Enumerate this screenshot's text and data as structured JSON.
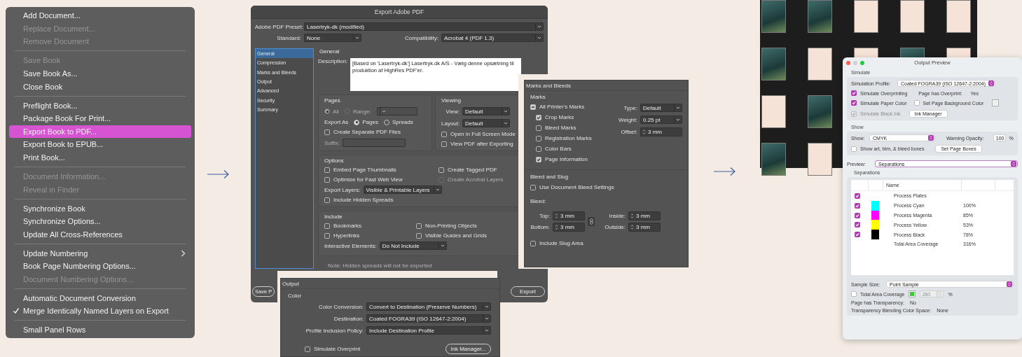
{
  "menu": {
    "items": [
      {
        "kind": "item",
        "label": "Add Document...",
        "disabled": false,
        "selected": false,
        "checked": false,
        "submenu": false
      },
      {
        "kind": "item",
        "label": "Replace Document...",
        "disabled": true,
        "selected": false,
        "checked": false,
        "submenu": false
      },
      {
        "kind": "item",
        "label": "Remove Document",
        "disabled": true,
        "selected": false,
        "checked": false,
        "submenu": false
      },
      {
        "kind": "separator"
      },
      {
        "kind": "item",
        "label": "Save Book",
        "disabled": true,
        "selected": false,
        "checked": false,
        "submenu": false
      },
      {
        "kind": "item",
        "label": "Save Book As...",
        "disabled": false,
        "selected": false,
        "checked": false,
        "submenu": false
      },
      {
        "kind": "item",
        "label": "Close Book",
        "disabled": false,
        "selected": false,
        "checked": false,
        "submenu": false
      },
      {
        "kind": "separator"
      },
      {
        "kind": "item",
        "label": "Preflight Book...",
        "disabled": false,
        "selected": false,
        "checked": false,
        "submenu": false
      },
      {
        "kind": "item",
        "label": "Package Book For Print...",
        "disabled": false,
        "selected": false,
        "checked": false,
        "submenu": false
      },
      {
        "kind": "item",
        "label": "Export Book to PDF...",
        "disabled": false,
        "selected": true,
        "checked": false,
        "submenu": false
      },
      {
        "kind": "item",
        "label": "Export Book to EPUB...",
        "disabled": false,
        "selected": false,
        "checked": false,
        "submenu": false
      },
      {
        "kind": "item",
        "label": "Print Book...",
        "disabled": false,
        "selected": false,
        "checked": false,
        "submenu": false
      },
      {
        "kind": "separator"
      },
      {
        "kind": "item",
        "label": "Document Information...",
        "disabled": true,
        "selected": false,
        "checked": false,
        "submenu": false
      },
      {
        "kind": "item",
        "label": "Reveal in Finder",
        "disabled": true,
        "selected": false,
        "checked": false,
        "submenu": false
      },
      {
        "kind": "separator"
      },
      {
        "kind": "item",
        "label": "Synchronize Book",
        "disabled": false,
        "selected": false,
        "checked": false,
        "submenu": false
      },
      {
        "kind": "item",
        "label": "Synchronize Options...",
        "disabled": false,
        "selected": false,
        "checked": false,
        "submenu": false
      },
      {
        "kind": "item",
        "label": "Update All Cross-References",
        "disabled": false,
        "selected": false,
        "checked": false,
        "submenu": false
      },
      {
        "kind": "separator"
      },
      {
        "kind": "item",
        "label": "Update Numbering",
        "disabled": false,
        "selected": false,
        "checked": false,
        "submenu": true
      },
      {
        "kind": "item",
        "label": "Book Page Numbering Options...",
        "disabled": false,
        "selected": false,
        "checked": false,
        "submenu": false
      },
      {
        "kind": "item",
        "label": "Document Numbering Options...",
        "disabled": true,
        "selected": false,
        "checked": false,
        "submenu": false
      },
      {
        "kind": "separator"
      },
      {
        "kind": "item",
        "label": "Automatic Document Conversion",
        "disabled": false,
        "selected": false,
        "checked": false,
        "submenu": false
      },
      {
        "kind": "item",
        "label": "Merge Identically Named Layers on Export",
        "disabled": false,
        "selected": false,
        "checked": true,
        "submenu": false
      },
      {
        "kind": "separator"
      },
      {
        "kind": "item",
        "label": "Small Panel Rows",
        "disabled": false,
        "selected": false,
        "checked": false,
        "submenu": false
      }
    ]
  },
  "export_dialog": {
    "title": "Export Adobe PDF",
    "preset": {
      "label": "Adobe PDF Preset:",
      "value": "Lasertryk-dk (modified)"
    },
    "standard": {
      "label": "Standard:",
      "value": "None"
    },
    "compatibility": {
      "label": "Compatibility:",
      "value": "Acrobat 4 (PDF 1.3)"
    },
    "sidebar": [
      {
        "label": "General",
        "selected": true
      },
      {
        "label": "Compression",
        "selected": false
      },
      {
        "label": "Marks and Bleeds",
        "selected": false
      },
      {
        "label": "Output",
        "selected": false
      },
      {
        "label": "Advanced",
        "selected": false
      },
      {
        "label": "Security",
        "selected": false
      },
      {
        "label": "Summary",
        "selected": false
      }
    ],
    "section_title": "General",
    "description": {
      "label": "Description:",
      "value": "[Based on 'Lasertryk-dk'] Lasertryk.dk A/S - Vælg denne opsætning til produktion af HighRes PDF'er."
    },
    "pages": {
      "title": "Pages",
      "range_options": [
        {
          "label": "All",
          "selected": true,
          "disabled": true
        },
        {
          "label": "Range:",
          "selected": false,
          "disabled": true
        }
      ],
      "export_as_label": "Export As",
      "export_as": [
        {
          "label": "Pages",
          "selected": true
        },
        {
          "label": "Spreads",
          "selected": false
        }
      ],
      "separate_files": {
        "label": "Create Separate PDF Files",
        "checked": false
      },
      "suffix_label": "Suffix:"
    },
    "viewing": {
      "title": "Viewing",
      "view": {
        "label": "View:",
        "value": "Default"
      },
      "layout": {
        "label": "Layout:",
        "value": "Default"
      },
      "checkboxes": [
        {
          "label": "Open in Full Screen Mode",
          "checked": false
        },
        {
          "label": "View PDF after Exporting",
          "checked": false
        }
      ]
    },
    "options": {
      "title": "Options",
      "checkboxes": [
        {
          "label": "Embed Page Thumbnails",
          "checked": false,
          "disabled": false
        },
        {
          "label": "Create Tagged PDF",
          "checked": false,
          "disabled": false
        },
        {
          "label": "Optimize for Fast Web View",
          "checked": false,
          "disabled": false
        },
        {
          "label": "Create Acrobat Layers",
          "checked": false,
          "disabled": true
        }
      ],
      "export_layers": {
        "label": "Export Layers:",
        "value": "Visible & Printable Layers"
      },
      "hidden_spreads": {
        "label": "Include Hidden Spreads",
        "checked": false
      }
    },
    "include": {
      "title": "Include",
      "checkboxes": [
        {
          "label": "Bookmarks",
          "checked": false
        },
        {
          "label": "Non-Printing Objects",
          "checked": false
        },
        {
          "label": "Hyperlinks",
          "checked": false
        },
        {
          "label": "Visible Guides and Grids",
          "checked": false
        }
      ],
      "interactive": {
        "label": "Interactive Elements:",
        "value": "Do Not Include"
      }
    },
    "note": "Note: Hidden spreads will not be exported",
    "buttons": [
      "Save P",
      "Export"
    ]
  },
  "marks_panel": {
    "title": "Marks and Bleeds",
    "marks_title": "Marks",
    "all_marks": {
      "label": "All Printer's Marks",
      "mixed": true
    },
    "marks": [
      {
        "label": "Crop Marks",
        "checked": true
      },
      {
        "label": "Bleed Marks",
        "checked": false
      },
      {
        "label": "Registration Marks",
        "checked": false
      },
      {
        "label": "Color Bars",
        "checked": false
      },
      {
        "label": "Page Information",
        "checked": true
      }
    ],
    "type": {
      "label": "Type:",
      "value": "Default"
    },
    "weight": {
      "label": "Weight:",
      "value": "0.25 pt"
    },
    "offset": {
      "label": "Offset:",
      "value": "3 mm"
    },
    "bleed_title": "Bleed and Slug",
    "use_document_bleed": {
      "label": "Use Document Bleed Settings",
      "checked": false
    },
    "bleed_label": "Bleed:",
    "bleed_fields": [
      {
        "label": "Top:",
        "value": "3 mm"
      },
      {
        "label": "Inside:",
        "value": "3 mm"
      },
      {
        "label": "Bottom:",
        "value": "3 mm"
      },
      {
        "label": "Outside:",
        "value": "3 mm"
      }
    ],
    "include_slug": {
      "label": "Include Slug Area",
      "checked": false
    }
  },
  "output_panel": {
    "title": "Output",
    "section_title": "Color",
    "rows": [
      {
        "label": "Color Conversion:",
        "value": "Convert to Destination (Preserve Numbers)"
      },
      {
        "label": "Destination:",
        "value": "Coated FOGRA39 (ISO 12647-2:2004)"
      },
      {
        "label": "Profile Inclusion Policy:",
        "value": "Include Destination Profile"
      }
    ],
    "simulate_overprint": {
      "label": "Simulate Overprint",
      "checked": false
    },
    "ink_manager": "Ink Manager..."
  },
  "output_preview": {
    "title": "Output Preview",
    "simulate": {
      "title": "Simulate",
      "profile": {
        "label": "Simulation Profile:",
        "value": "Coated FOGRA39 (ISO 12647-2:2004)"
      },
      "overprinting": {
        "label": "Simulate Overprinting",
        "checked": true
      },
      "page_overprint": {
        "label": "Page has Overprint:",
        "value": "Yes"
      },
      "paper_color": {
        "label": "Simulate Paper Color",
        "checked": true
      },
      "background_color": {
        "label": "Set Page Background Color",
        "checked": false
      },
      "black_ink": {
        "label": "Simulate Black Ink",
        "checked": true,
        "disabled": true
      },
      "ink_manager": "Ink Manager"
    },
    "show": {
      "title": "Show",
      "show": {
        "label": "Show:",
        "value": "CMYK"
      },
      "warning": {
        "label": "Warning Opacity:",
        "value": "100",
        "unit": "%"
      },
      "boxes": {
        "label": "Show art, trim, & bleed boxes",
        "checked": false
      },
      "page_boxes": "Set Page Boxes"
    },
    "preview": {
      "label": "Preview:",
      "value": "Separations"
    },
    "separations": {
      "title": "Separations",
      "column": "Name",
      "rows": [
        {
          "kind": "group",
          "name": "Process Plates",
          "checked": true
        },
        {
          "kind": "ink",
          "name": "Process Cyan",
          "checked": true,
          "color": "#00ffff",
          "value": "100%"
        },
        {
          "kind": "ink",
          "name": "Process Magenta",
          "checked": true,
          "color": "#ff00ff",
          "value": "85%"
        },
        {
          "kind": "ink",
          "name": "Process Yellow",
          "checked": true,
          "color": "#ffff00",
          "value": "53%"
        },
        {
          "kind": "ink",
          "name": "Process Black",
          "checked": true,
          "color": "#000000",
          "value": "78%"
        },
        {
          "kind": "total",
          "name": "Total Area Coverage",
          "value": "316%"
        }
      ]
    },
    "sample_size": {
      "label": "Sample Size:",
      "value": "Point Sample"
    },
    "total_area": {
      "label": "Total Area Coverage",
      "checked": false,
      "value": "280",
      "unit": "%"
    },
    "transparency": {
      "label": "Page has Transparency:",
      "value": "No"
    },
    "blending": {
      "label": "Transparency Blending Color Space:",
      "value": "None"
    }
  }
}
